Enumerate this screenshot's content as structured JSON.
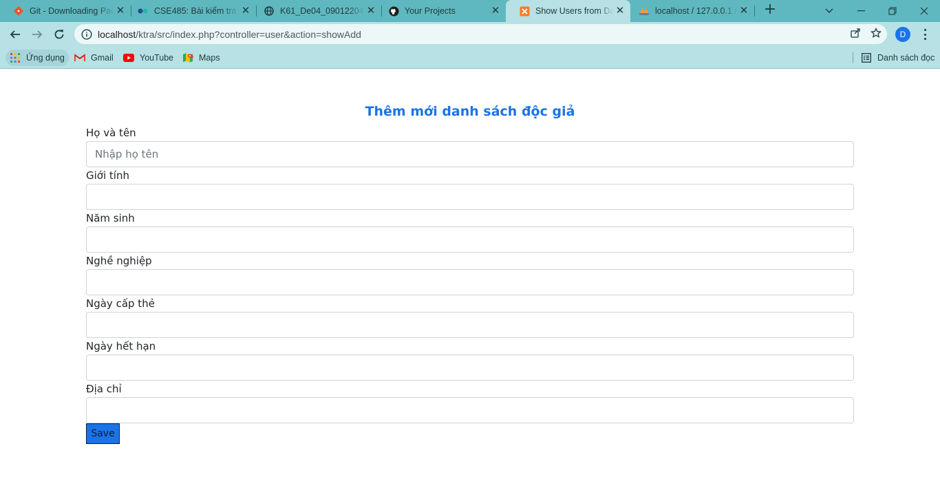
{
  "browser": {
    "tabs": [
      {
        "title": "Git - Downloading Package",
        "active": false
      },
      {
        "title": "CSE485: Bài kiểm tra số 1",
        "active": false
      },
      {
        "title": "K61_De04_09012204.pdf",
        "active": false
      },
      {
        "title": "Your Projects",
        "active": false
      },
      {
        "title": "Show Users from Database",
        "active": true
      },
      {
        "title": "localhost / 127.0.0.1 / ",
        "active": false
      }
    ],
    "address": {
      "host": "localhost",
      "path": "/ktra/src/index.php?controller=user&action=showAdd"
    },
    "profile_initial": "D",
    "bookmarks": [
      {
        "label": "Ứng dụng",
        "icon": "apps-grid-icon"
      },
      {
        "label": "Gmail",
        "icon": "gmail-icon"
      },
      {
        "label": "YouTube",
        "icon": "youtube-icon"
      },
      {
        "label": "Maps",
        "icon": "maps-icon"
      }
    ],
    "reading_list_label": "Danh sách đọc"
  },
  "page": {
    "title": "Thêm mới danh sách độc giả",
    "fields": [
      {
        "label": "Họ và tên",
        "placeholder": "Nhập họ tên",
        "value": ""
      },
      {
        "label": "Giới tính",
        "placeholder": "",
        "value": ""
      },
      {
        "label": "Năm sinh",
        "placeholder": "",
        "value": ""
      },
      {
        "label": "Nghề nghiệp",
        "placeholder": "",
        "value": ""
      },
      {
        "label": "Ngày cấp thẻ",
        "placeholder": "",
        "value": ""
      },
      {
        "label": "Ngày hết hạn",
        "placeholder": "",
        "value": ""
      },
      {
        "label": "Địa chỉ",
        "placeholder": "",
        "value": ""
      }
    ],
    "save_label": "Save"
  },
  "colors": {
    "accent": "#1a73e8",
    "tabstrip": "#5fb8bf",
    "toolbar": "#b7e1e4"
  }
}
